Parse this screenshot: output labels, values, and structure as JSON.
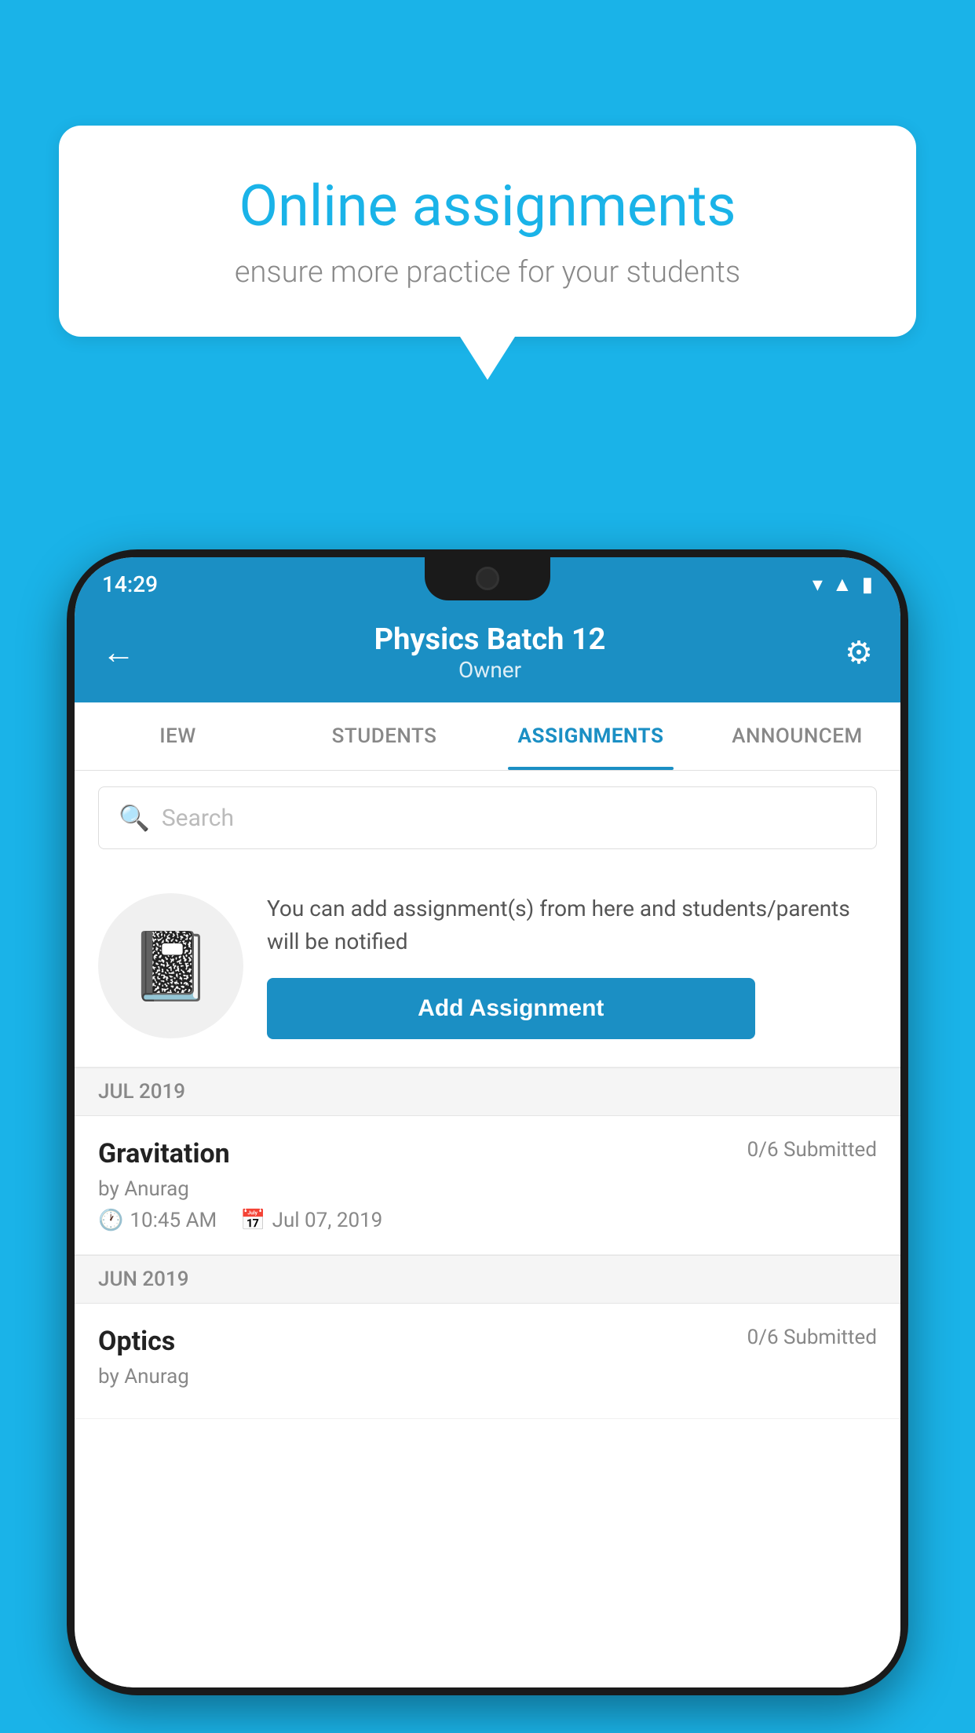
{
  "background_color": "#1ab3e8",
  "speech_bubble": {
    "title": "Online assignments",
    "subtitle": "ensure more practice for your students"
  },
  "phone": {
    "status_bar": {
      "time": "14:29",
      "icons": [
        "wifi",
        "signal",
        "battery"
      ]
    },
    "header": {
      "title": "Physics Batch 12",
      "subtitle": "Owner",
      "back_label": "←",
      "settings_label": "⚙"
    },
    "tabs": [
      {
        "label": "IEW",
        "active": false
      },
      {
        "label": "STUDENTS",
        "active": false
      },
      {
        "label": "ASSIGNMENTS",
        "active": true
      },
      {
        "label": "ANNOUNCEM",
        "active": false
      }
    ],
    "search": {
      "placeholder": "Search"
    },
    "promo": {
      "text": "You can add assignment(s) from here and students/parents will be notified",
      "button_label": "Add Assignment"
    },
    "sections": [
      {
        "header": "JUL 2019",
        "assignments": [
          {
            "name": "Gravitation",
            "status": "0/6 Submitted",
            "by": "by Anurag",
            "time": "10:45 AM",
            "date": "Jul 07, 2019"
          }
        ]
      },
      {
        "header": "JUN 2019",
        "assignments": [
          {
            "name": "Optics",
            "status": "0/6 Submitted",
            "by": "by Anurag",
            "time": "",
            "date": ""
          }
        ]
      }
    ]
  }
}
